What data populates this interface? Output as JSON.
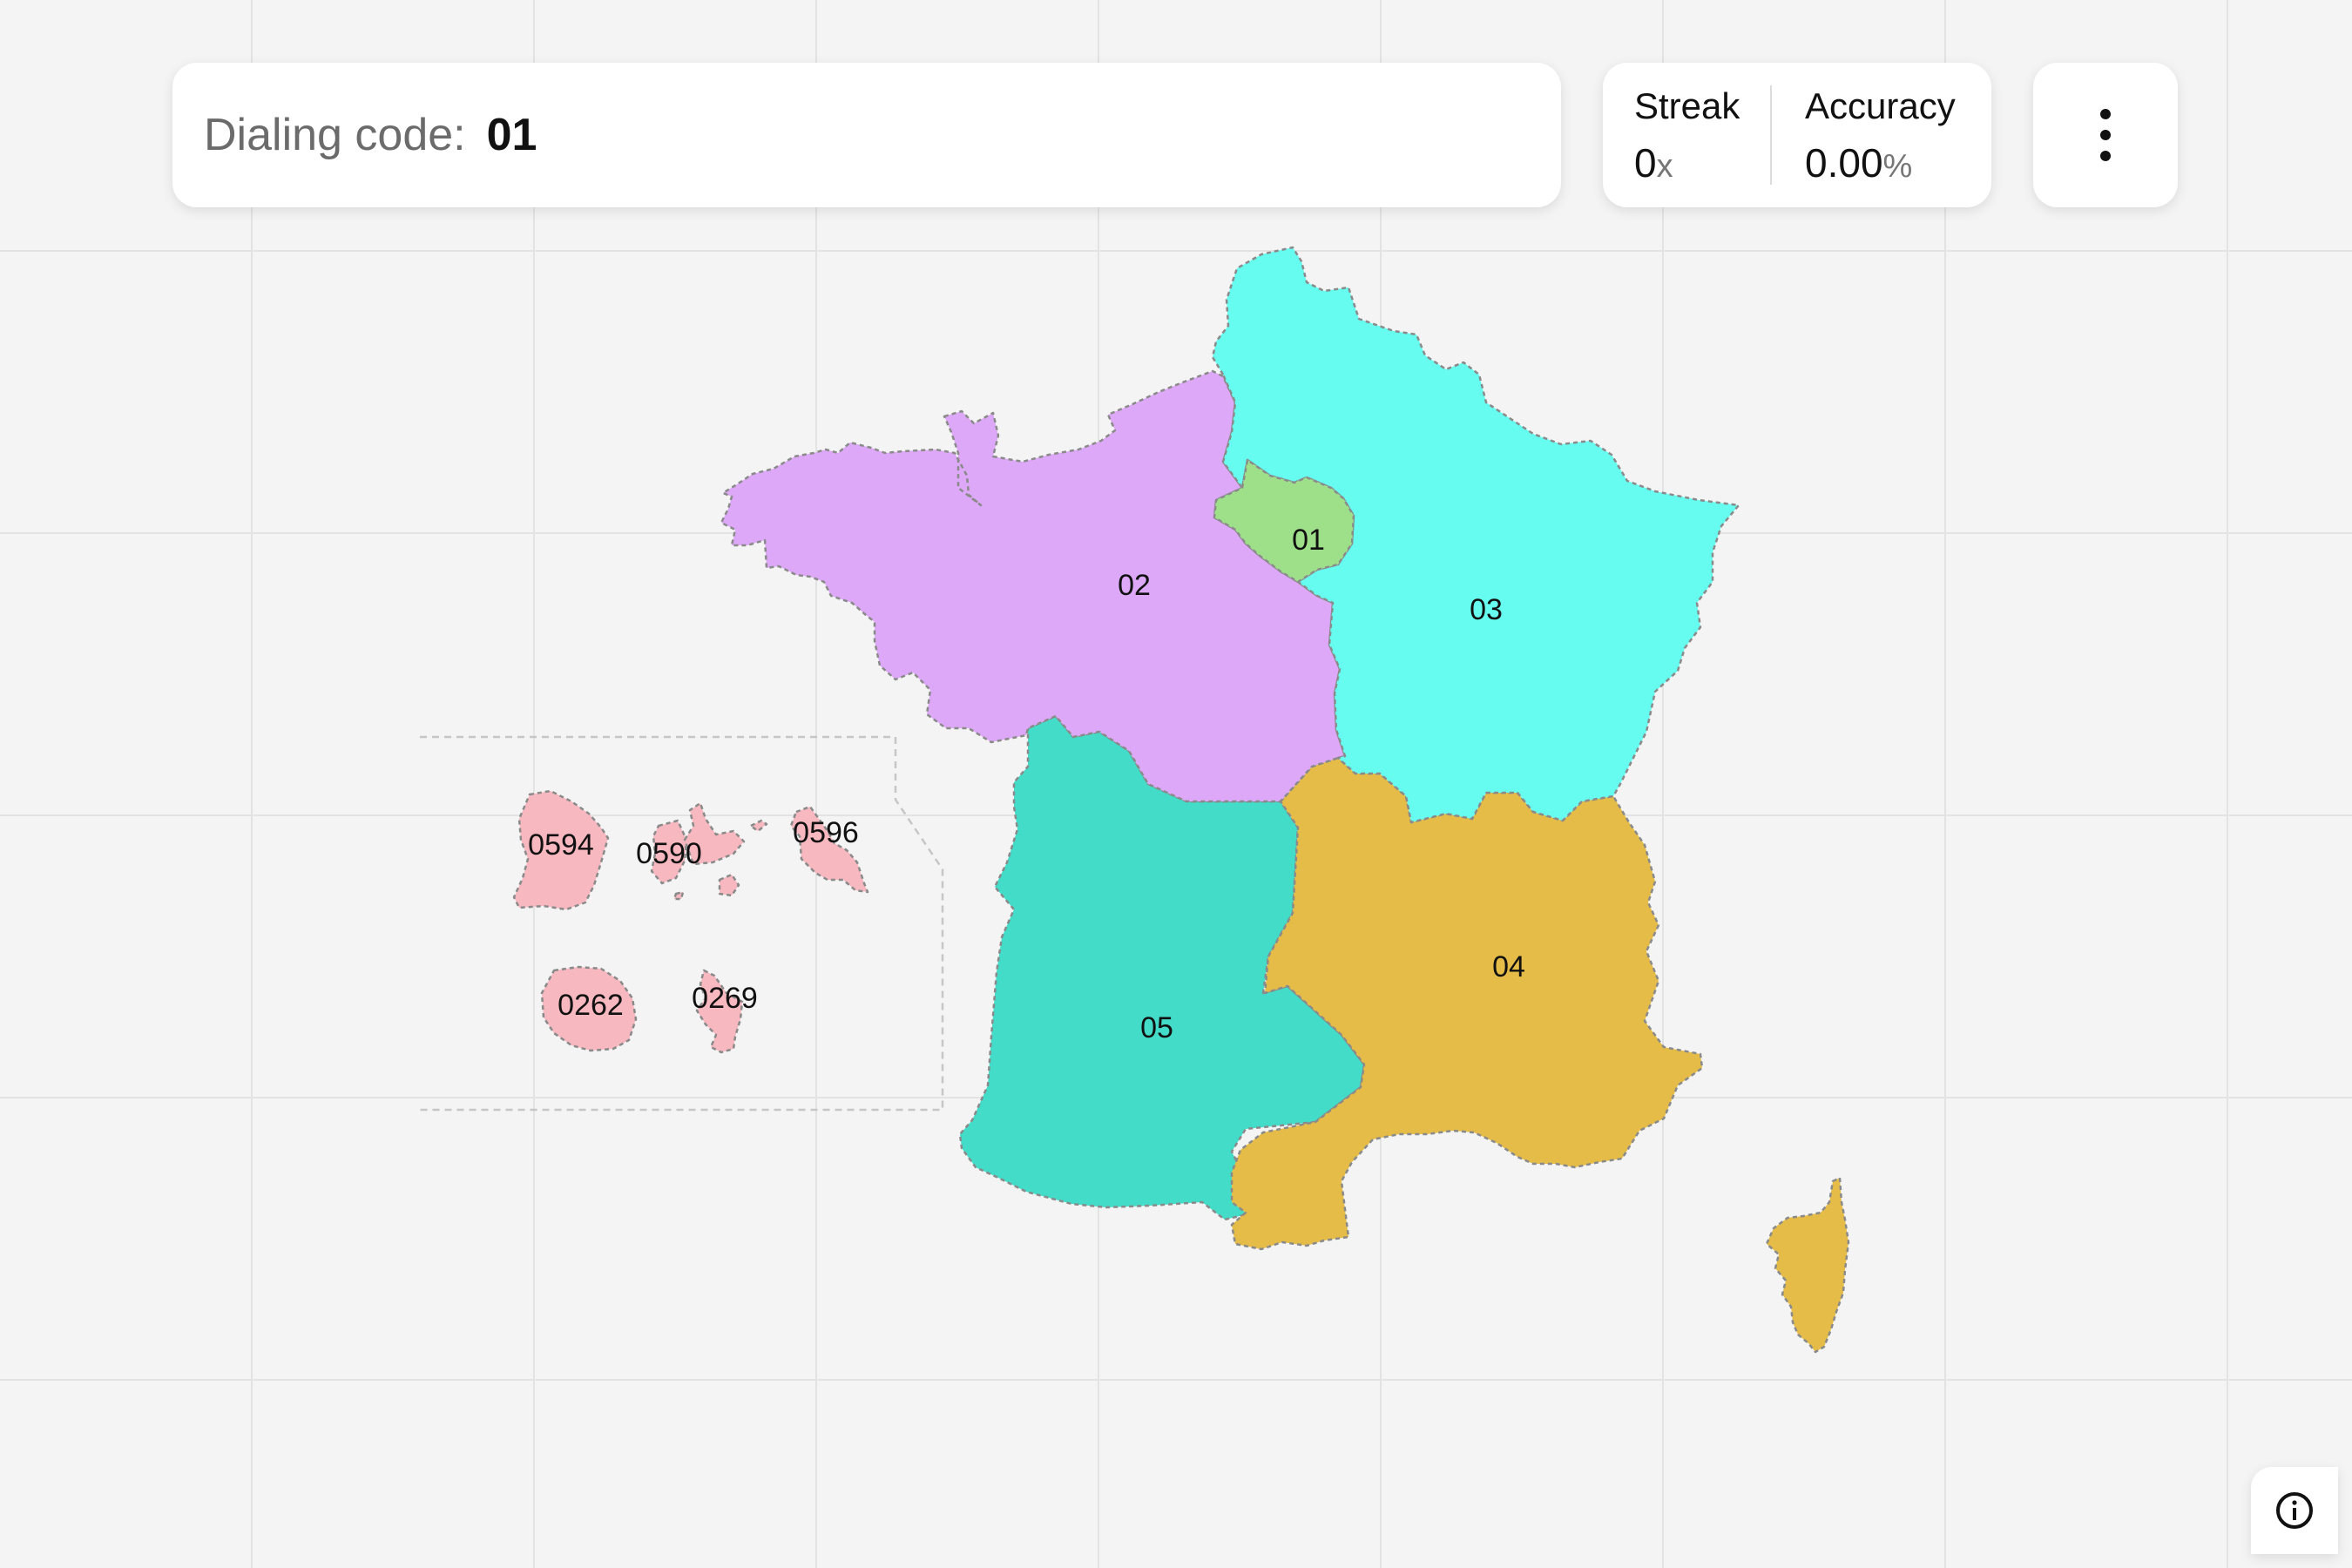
{
  "prompt": {
    "label": "Dialing code:",
    "value": "01"
  },
  "stats": {
    "streak": {
      "title": "Streak",
      "value": "0",
      "unit": "x"
    },
    "accuracy": {
      "title": "Accuracy",
      "value": "0.00",
      "unit": "%"
    }
  },
  "icons": {
    "menu": "vertical-dots-icon",
    "info": "info-circle-icon"
  },
  "colors": {
    "r01": "#9ee08a",
    "r02": "#dda8f7",
    "r03": "#66fcf0",
    "r04": "#e5bc48",
    "r05": "#42dcc9",
    "overseas": "#f7b8c0"
  },
  "regions": {
    "r01": "01",
    "r02": "02",
    "r03": "03",
    "r04": "04",
    "r05": "05",
    "r0594": "0594",
    "r0590": "0590",
    "r0596": "0596",
    "r0262": "0262",
    "r0269": "0269"
  }
}
